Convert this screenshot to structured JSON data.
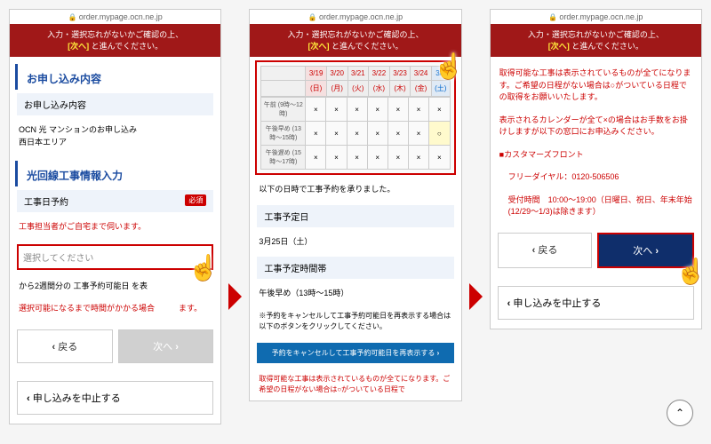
{
  "url": "order.mypage.ocn.ne.jp",
  "banner": {
    "l1": "入力・選択忘れがないかご確認の上、",
    "l2a": "[次へ]",
    "l2b": " と進んでください。"
  },
  "s1": {
    "h1": "お申し込み内容",
    "sub1": "お申し込み内容",
    "t1": "OCN 光 マンションのお申し込み",
    "t2": "西日本エリア",
    "h2": "光回線工事情報入力",
    "sub2": "工事日予約",
    "req": "必須",
    "note1": "工事担当者がご自宅まで伺います。",
    "sel": "選択してください",
    "note2": "から2週間分の 工事予約可能日 を表",
    "note3": "選択可能になるまで時間がかかる場合　　　ます。",
    "back": "戻る",
    "next": "次へ",
    "cancel": "申し込みを中止する"
  },
  "s2": {
    "days": [
      "3/19",
      "3/20",
      "3/21",
      "3/22",
      "3/23",
      "3/24",
      "3/2"
    ],
    "wd": [
      "(日)",
      "(月)",
      "(火)",
      "(水)",
      "(木)",
      "(金)",
      "(土)"
    ],
    "rows": [
      {
        "l": "午前\n(9時〜12時)",
        "v": [
          "×",
          "×",
          "×",
          "×",
          "×",
          "×",
          "×"
        ]
      },
      {
        "l": "午後早め\n(13時〜15時)",
        "v": [
          "×",
          "×",
          "×",
          "×",
          "×",
          "×",
          "○"
        ]
      },
      {
        "l": "午後遅め\n(15時〜17時)",
        "v": [
          "×",
          "×",
          "×",
          "×",
          "×",
          "×",
          "×"
        ]
      }
    ],
    "conf": "以下の日時で工事予約を承りました。",
    "dL": "工事予定日",
    "dV": "3月25日（土）",
    "tL": "工事予定時間帯",
    "tV": "午後早め（13時〜15時）",
    "rebook1": "※予約をキャンセルして工事予約可能日を再表示する場合は以下のボタンをクリックしてください。",
    "rebookBtn": "予約をキャンセルして工事予約可能日を再表示する",
    "tail": "取得可能な工事は表示されているものが全てになります。ご希望の日程がない場合は○がついている日程で"
  },
  "s3": {
    "p1": "取得可能な工事は表示されているものが全てになります。ご希望の日程がない場合は○がついている日程での取得をお願いいたします。",
    "p2": "表示されるカレンダーが全て×の場合はお手数をお掛けしますが以下の窓口にお申込みください。",
    "cf": "■カスタマーズフロント",
    "tel": "フリーダイヤル：0120-506506",
    "hrs": "受付時間　10:00〜19:00（日曜日、祝日、年末年始(12/29〜1/3)は除きます）",
    "back": "戻る",
    "next": "次へ",
    "cancel": "申し込みを中止する"
  }
}
